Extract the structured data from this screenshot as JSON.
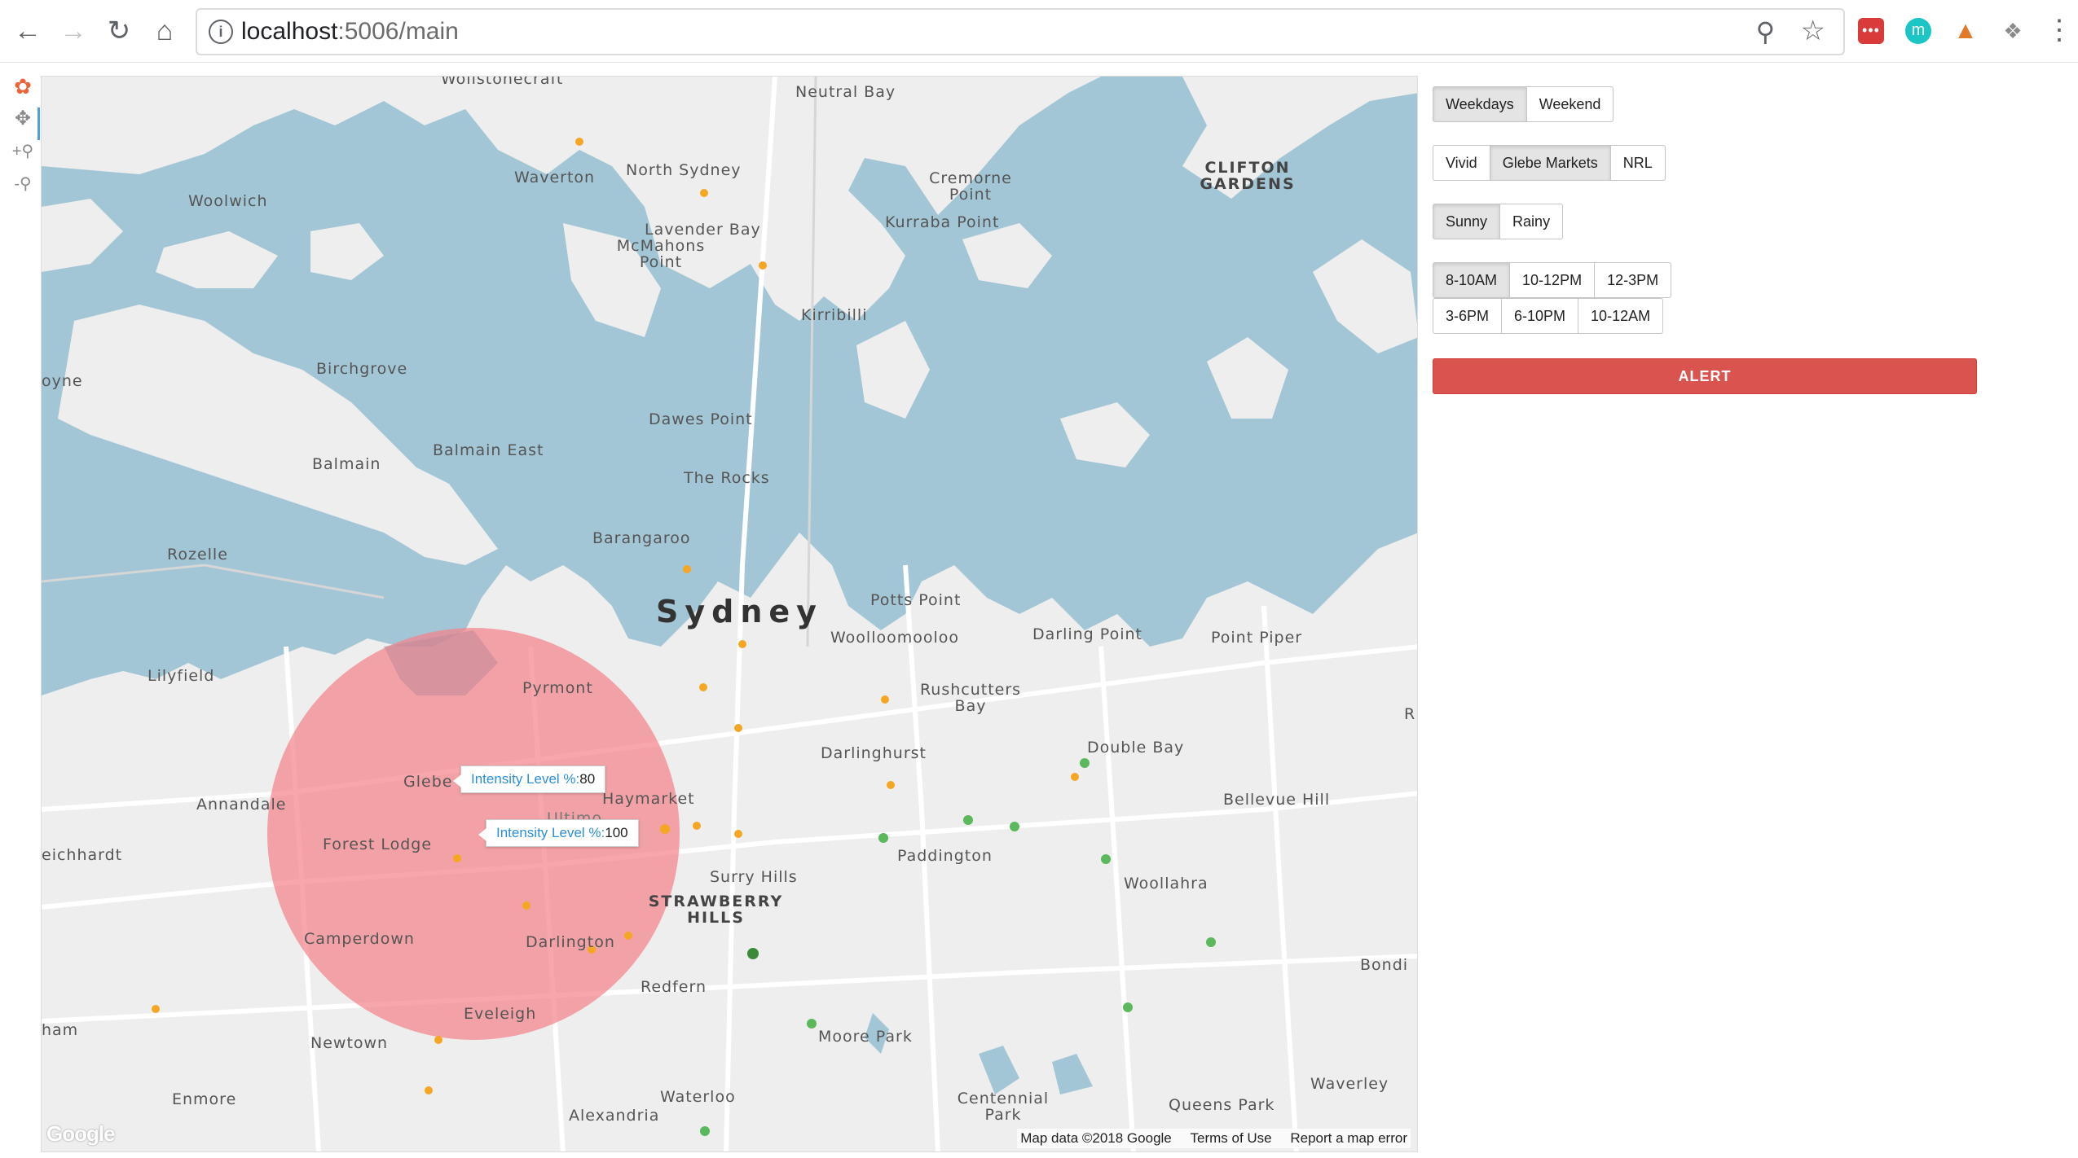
{
  "browser": {
    "url_host": "localhost",
    "url_rest": ":5006/main",
    "back_icon": "arrow-left-icon",
    "forward_icon": "arrow-right-icon",
    "reload_icon": "reload-icon",
    "home_icon": "home-icon",
    "ext1": "•••",
    "ext2": "m"
  },
  "map": {
    "labels": {
      "wollstonecraft": "Wollstonecraft",
      "neutral_bay": "Neutral Bay",
      "waverton": "Waverton",
      "north_sydney": "North Sydney",
      "cremorne_point": "Cremorne Point",
      "clifton_gardens": "CLIFTON GARDENS",
      "woolwich": "Woolwich",
      "lavender_bay": "Lavender Bay",
      "mcmahons_point": "McMahons Point",
      "kurraba_point": "Kurraba Point",
      "kirribilli": "Kirribilli",
      "birchgrove": "Birchgrove",
      "dawes_point": "Dawes Point",
      "balmain": "Balmain",
      "balmain_east": "Balmain East",
      "the_rocks": "The Rocks",
      "rozelle": "Rozelle",
      "barangaroo": "Barangaroo",
      "sydney": "Sydney",
      "potts_point": "Potts Point",
      "woolloomooloo": "Woolloomooloo",
      "darling_point": "Darling Point",
      "point_piper": "Point Piper",
      "lilyfield": "Lilyfield",
      "pyrmont": "Pyrmont",
      "rushcutters_bay": "Rushcutters Bay",
      "double_bay": "Double Bay",
      "darlinghurst": "Darlinghurst",
      "glebe": "Glebe",
      "annandale": "Annandale",
      "haymarket": "Haymarket",
      "bellevue_hill": "Bellevue Hill",
      "forest_lodge": "Forest Lodge",
      "paddington": "Paddington",
      "leichhardt": "eichhardt",
      "surry_hills": "Surry Hills",
      "woollahra": "Woollahra",
      "strawberry_hills": "STRAWBERRY HILLS",
      "camperdown": "Camperdown",
      "darlington": "Darlington",
      "redfern": "Redfern",
      "bondi": "Bondi",
      "eveleigh": "Eveleigh",
      "newtown": "Newtown",
      "moore_park": "Moore Park",
      "waverley": "Waverley",
      "centennial_park": "Centennial Park",
      "queens_park": "Queens Park",
      "enmore": "Enmore",
      "waterloo": "Waterloo",
      "alexandria": "Alexandria",
      "haberfield": "ham",
      "coyne": "oyne",
      "ultimo": "Ultimo",
      "r_edge": "R"
    },
    "tooltips": [
      {
        "key": "Intensity Level %:",
        "value": "80"
      },
      {
        "key": "Intensity Level %:",
        "value": "100"
      }
    ],
    "attribution": {
      "map_data": "Map data ©2018 Google",
      "terms": "Terms of Use",
      "report": "Report a map error"
    },
    "logo": "Google",
    "colors": {
      "water": "#a3c6d6",
      "land": "#eeeeee",
      "heat": "#f4848a",
      "green_marker": "#5cb85c",
      "orange_marker": "#f5a623"
    }
  },
  "panel": {
    "day_group": [
      {
        "label": "Weekdays",
        "active": true
      },
      {
        "label": "Weekend",
        "active": false
      }
    ],
    "event_group": [
      {
        "label": "Vivid",
        "active": false
      },
      {
        "label": "Glebe Markets",
        "active": true
      },
      {
        "label": "NRL",
        "active": false
      }
    ],
    "weather_group": [
      {
        "label": "Sunny",
        "active": true
      },
      {
        "label": "Rainy",
        "active": false
      }
    ],
    "time_row1": [
      {
        "label": "8-10AM",
        "active": true
      },
      {
        "label": "10-12PM",
        "active": false
      },
      {
        "label": "12-3PM",
        "active": false
      }
    ],
    "time_row2": [
      {
        "label": "3-6PM",
        "active": false
      },
      {
        "label": "6-10PM",
        "active": false
      },
      {
        "label": "10-12AM",
        "active": false
      }
    ],
    "alert_label": "ALERT"
  }
}
